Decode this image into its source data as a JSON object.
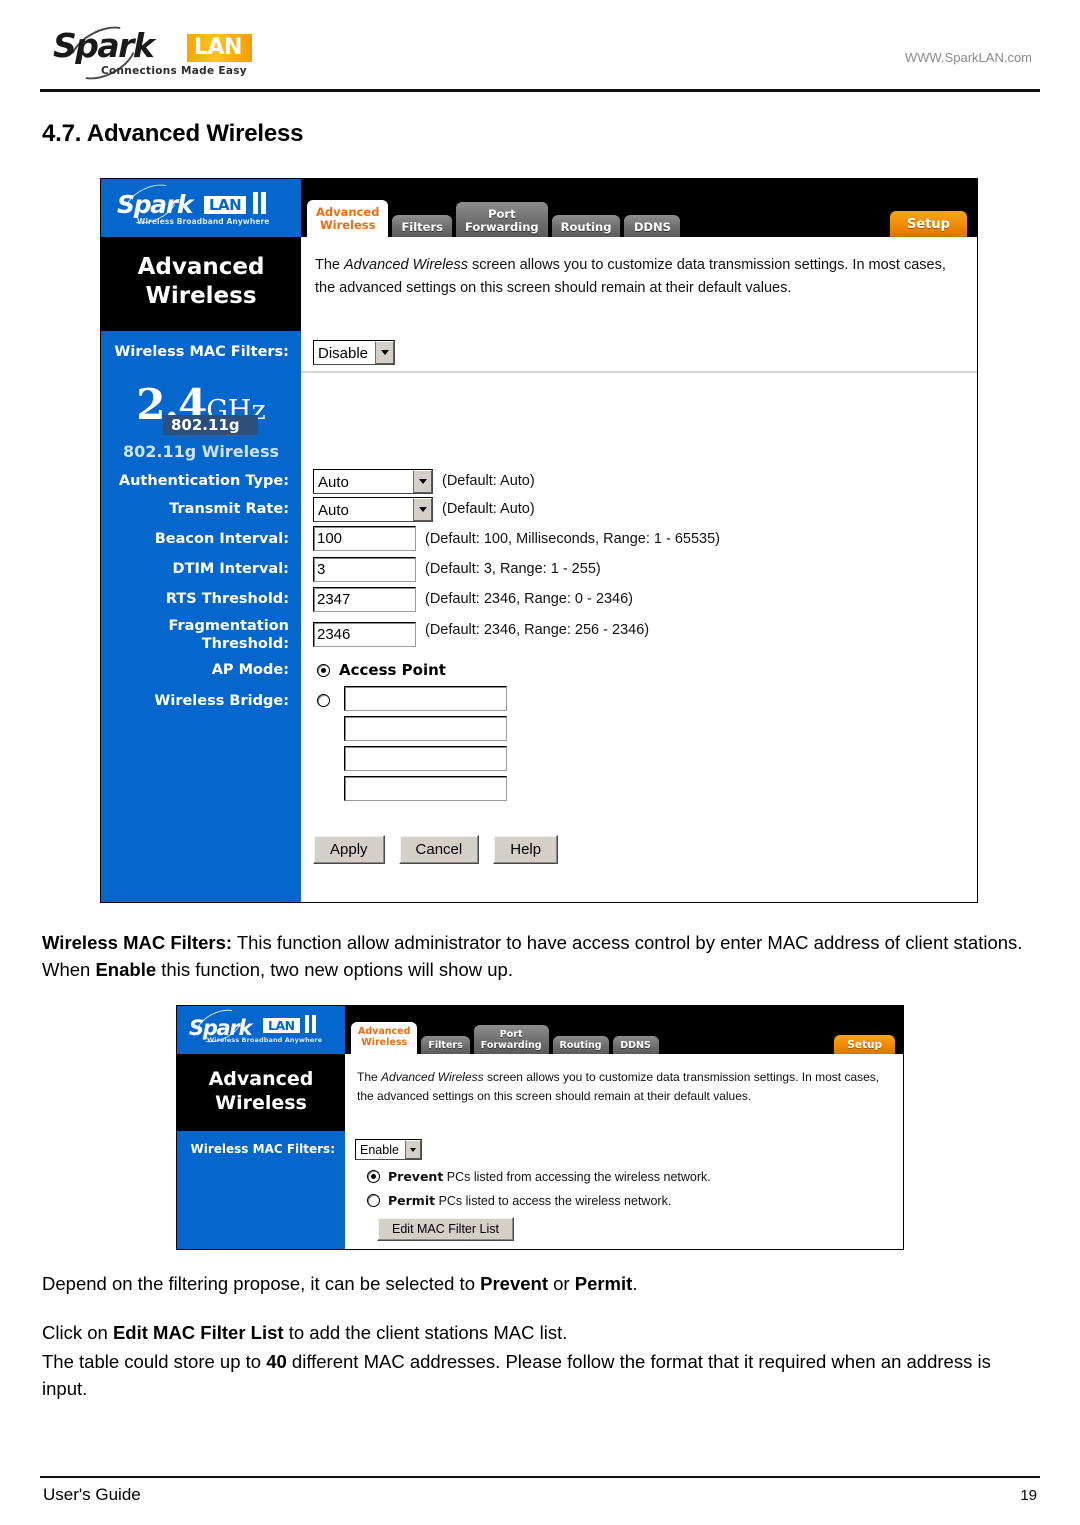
{
  "header": {
    "logo_main": "Spark",
    "logo_accent": "LAN",
    "logo_tagline": "Connections Made Easy",
    "url": "WWW.SparkLAN.com"
  },
  "section": {
    "title": "4.7. Advanced Wireless"
  },
  "router_ui": {
    "logo_main": "Spark",
    "logo_accent": "LAN",
    "logo_tagline": "Wireless Broadband Anywhere",
    "tabs": [
      {
        "label": "Advanced Wireless",
        "line1": "Advanced",
        "line2": "Wireless",
        "active": true
      },
      {
        "label": "Filters",
        "line1": "Filters",
        "line2": "",
        "active": false
      },
      {
        "label": "Port Forwarding",
        "line1": "Port",
        "line2": "Forwarding",
        "active": false
      },
      {
        "label": "Routing",
        "line1": "Routing",
        "line2": "",
        "active": false
      },
      {
        "label": "DDNS",
        "line1": "DDNS",
        "line2": "",
        "active": false
      }
    ],
    "setup_button": "Setup",
    "panel_title_line1": "Advanced",
    "panel_title_line2": "Wireless",
    "description_pre": "The ",
    "description_em": "Advanced Wireless",
    "description_post": " screen allows you to customize data transmission settings. In most cases, the advanced settings on this screen should remain at their default values.",
    "mac_filters_label": "Wireless MAC Filters:",
    "mac_filters_value": "Disable",
    "band_badge": {
      "number": "2.4",
      "unit": "GHz",
      "standard": "802.11g",
      "subtitle": "802.11g Wireless"
    },
    "fields": [
      {
        "label": "Authentication Type:",
        "type": "select",
        "value": "Auto",
        "note": "(Default: Auto)"
      },
      {
        "label": "Transmit Rate:",
        "type": "select",
        "value": "Auto",
        "note": "(Default: Auto)"
      },
      {
        "label": "Beacon Interval:",
        "type": "text",
        "value": "100",
        "note": "(Default: 100, Milliseconds, Range: 1 - 65535)"
      },
      {
        "label": "DTIM Interval:",
        "type": "text",
        "value": "3",
        "note": "(Default: 3, Range: 1 - 255)"
      },
      {
        "label": "RTS Threshold:",
        "type": "text",
        "value": "2347",
        "note": "(Default: 2346, Range: 0 - 2346)"
      },
      {
        "label": "Fragmentation Threshold:",
        "label_line1": "Fragmentation",
        "label_line2": "Threshold:",
        "type": "text",
        "value": "2346",
        "note": "(Default: 2346, Range: 256 - 2346)"
      }
    ],
    "ap_mode_label": "AP Mode:",
    "ap_mode_option": "Access Point",
    "ap_mode_selected": true,
    "wireless_bridge_label": "Wireless Bridge:",
    "wireless_bridge_selected": false,
    "wireless_bridge_values": [
      "",
      "",
      "",
      ""
    ],
    "buttons": {
      "apply": "Apply",
      "cancel": "Cancel",
      "help": "Help"
    }
  },
  "router_ui_2": {
    "mac_filters_label": "Wireless MAC Filters:",
    "mac_filters_value": "Enable",
    "prevent": {
      "bold": "Prevent",
      "rest": " PCs listed from accessing the wireless network.",
      "selected": true
    },
    "permit": {
      "bold": "Permit",
      "rest": " PCs listed to access the wireless network.",
      "selected": false
    },
    "edit_list_button": "Edit MAC Filter List"
  },
  "paragraphs": {
    "p1_bold": "Wireless MAC Filters:",
    "p1_part1": " This function allow administrator to have access control by enter MAC address of client stations. When ",
    "p1_bold2": "Enable",
    "p1_part2": " this function, two new options will show up.",
    "p2_part1": "Depend on the filtering propose, it can be selected to ",
    "p2_bold1": "Prevent",
    "p2_mid": " or ",
    "p2_bold2": "Permit",
    "p2_end": ".",
    "p3_part1": "Click on ",
    "p3_bold": "Edit MAC Filter List",
    "p3_part2": " to add the client stations MAC list.",
    "p4_part1": "The table could store up to ",
    "p4_bold": "40",
    "p4_part2": " different MAC addresses. Please follow the format that it required when an address is input."
  },
  "footer": {
    "label": "User's Guide",
    "page": "19"
  }
}
